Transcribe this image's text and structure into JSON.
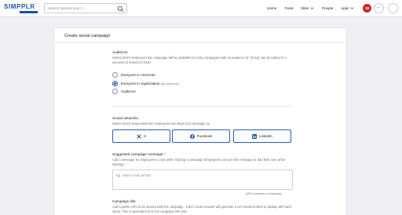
{
  "header": {
    "logo": "SIMPPLR",
    "search": {
      "placeholder": "Search Intranet Hub 1..."
    },
    "nav": [
      {
        "label": "Home",
        "dropdown": false
      },
      {
        "label": "Feed",
        "dropdown": false
      },
      {
        "label": "Sites",
        "dropdown": true
      },
      {
        "label": "People",
        "dropdown": false
      },
      {
        "label": "Apps",
        "dropdown": true
      }
    ],
    "notification_count": "38",
    "accent_color": "#1f4fa8",
    "badge_color": "#c8252c"
  },
  "form": {
    "title": "Create social campaign",
    "audience": {
      "label": "Audience",
      "help": "Select which employees this campaign will be available for (only campaigns with an audience of 'All org' can be added to a carousel or shared in feed)",
      "options": [
        {
          "label": "Everyone in Americas",
          "hint": "",
          "selected": false
        },
        {
          "label": "Everyone in organization",
          "hint": "(All segments)",
          "selected": true
        },
        {
          "label": "Audience",
          "hint": "",
          "selected": false
        }
      ]
    },
    "social_networks": {
      "label": "Social networks",
      "help": "Select which social networks employees can share this campaign on",
      "buttons": [
        {
          "label": "X",
          "icon": "x-logo-icon"
        },
        {
          "label": "Facebook",
          "icon": "facebook-icon"
        },
        {
          "label": "LinkedIn",
          "icon": "linkedin-icon"
        }
      ]
    },
    "message": {
      "label": "Suggested campaign message *",
      "help": "Add a message for employees to use when sharing a campaign (Employees can use this message or add their own when sharing)",
      "placeholder": "Eg. Have a look at this!",
      "remaining": "(250 characters remaining)"
    },
    "link": {
      "label": "Campaign link",
      "help": "Add a public URL to be shared with this campaign - Each social network will generate a rich media embed to display with each share. This is generated from the campaign link URL"
    }
  }
}
